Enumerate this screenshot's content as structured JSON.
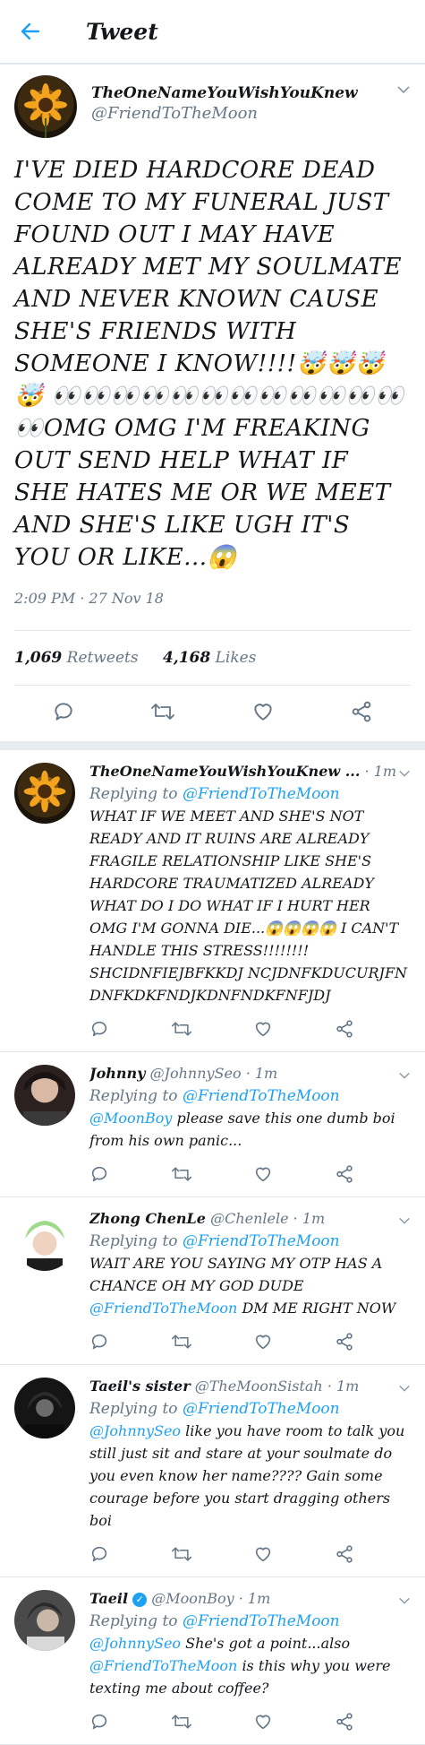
{
  "header": {
    "title": "Tweet"
  },
  "main_tweet": {
    "name": "TheOneNameYouWishYouKnew",
    "handle": "@FriendToTheMoon",
    "text": "I'VE DIED HARDCORE DEAD COME TO MY FUNERAL JUST FOUND OUT I MAY HAVE ALREADY MET MY SOULMATE AND NEVER KNOWN CAUSE SHE'S FRIENDS WITH SOMEONE I KNOW!!!!🤯🤯🤯🤯 👀👀👀👀👀👀👀👀👀👀👀👀👀OMG OMG I'M FREAKING OUT SEND HELP WHAT IF SHE HATES ME OR WE MEET AND SHE'S LIKE UGH IT'S YOU OR LIKE...😱",
    "timestamp": "2:09 PM · 27 Nov 18",
    "retweets_count": "1,069",
    "retweets_label": "Retweets",
    "likes_count": "4,168",
    "likes_label": "Likes"
  },
  "replies": [
    {
      "name": "TheOneNameYouWishYouKnew ...",
      "handle": "",
      "time": "· 1m",
      "replying_label": "Replying to",
      "replying_to": "@FriendToTheMoon",
      "text": "WHAT IF WE MEET AND SHE'S NOT READY AND IT RUINS ARE ALREADY FRAGILE RELATIONSHIP LIKE SHE'S HARDCORE TRAUMATIZED ALREADY WHAT DO I DO WHAT IF I HURT HER OMG I'M GONNA DIE...😱😱😱😱 I CAN'T HANDLE THIS STRESS!!!!!!!! SHCIDNFIEJBFKKDJ NCJDNFKDUCURJFN DNFKDKFNDJKDNFNDKFNFJDJ"
    },
    {
      "name": "Johnny",
      "handle": "@JohnnySeo",
      "time": "· 1m",
      "replying_label": "Replying to",
      "replying_to": "@FriendToTheMoon",
      "mention": "@MoonBoy",
      "text": "please save this one dumb boi from his own panic..."
    },
    {
      "name": "Zhong ChenLe",
      "handle": "@Chenlele",
      "time": "· 1m",
      "replying_label": "Replying to",
      "replying_to": "@FriendToTheMoon",
      "text_before": "WAIT ARE YOU SAYING MY OTP HAS A CHANCE OH MY GOD DUDE",
      "mention": "@FriendToTheMoon",
      "text_after": "DM ME RIGHT NOW"
    },
    {
      "name": "Taeil's sister",
      "handle": "@TheMoonSistah",
      "time": "· 1m",
      "replying_label": "Replying to",
      "replying_to": "@FriendToTheMoon",
      "mention": "@JohnnySeo",
      "text": "like you have room to talk you still just sit and stare at your soulmate do you even know her name???? Gain some courage before you start dragging others boi"
    },
    {
      "name": "Taeil",
      "verified": "✓",
      "handle": "@MoonBoy",
      "time": "· 1m",
      "replying_label": "Replying to",
      "replying_to": "@FriendToTheMoon",
      "mention": "@JohnnySeo",
      "text_1": "She's got a point...also",
      "mention_2": "@FriendToTheMoon",
      "text_2": "is this why you were texting me about coffee?"
    }
  ],
  "colors": {
    "accent": "#1da1f2",
    "secondary_text": "#657786",
    "divider": "#e1e8ed"
  }
}
